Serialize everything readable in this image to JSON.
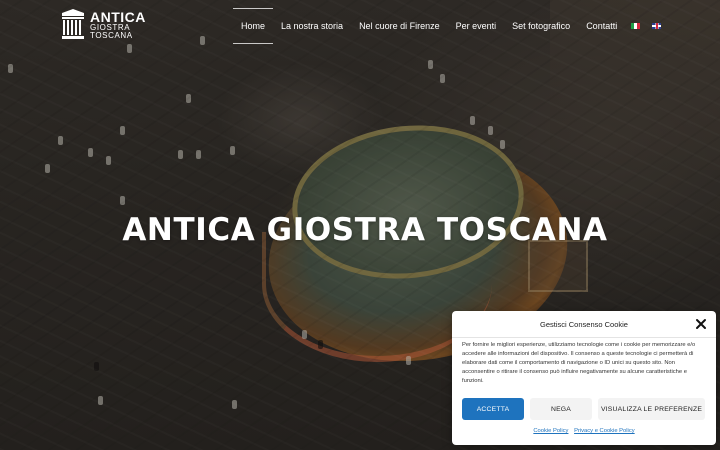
{
  "site": {
    "logo": {
      "line1": "ANTICA",
      "line2": "GIOSTRA",
      "line3": "TOSCANA"
    }
  },
  "nav": {
    "items": [
      {
        "label": "Home"
      },
      {
        "label": "La nostra storia"
      },
      {
        "label": "Nel cuore di Firenze"
      },
      {
        "label": "Per eventi"
      },
      {
        "label": "Set fotografico"
      },
      {
        "label": "Contatti"
      }
    ],
    "active_index": 0,
    "languages": [
      "it",
      "en"
    ]
  },
  "hero": {
    "title": "ANTICA GIOSTRA TOSCANA"
  },
  "cookie": {
    "title": "Gestisci Consenso Cookie",
    "body": "Per fornire le migliori esperienze, utilizziamo tecnologie come i cookie per memorizzare e/o accedere alle informazioni del dispositivo. Il consenso a queste tecnologie ci permetterà di elaborare dati come il comportamento di navigazione o ID unici su questo sito. Non acconsentire o ritirare il consenso può influire negativamente su alcune caratteristiche e funzioni.",
    "accept_label": "ACCETTA",
    "deny_label": "NEGA",
    "prefs_label": "VISUALIZZA LE PREFERENZE",
    "cookie_policy_label": "Cookie Policy",
    "privacy_label": "Privacy e Cookie Policy"
  },
  "colors": {
    "accent": "#1e73be",
    "button_secondary": "#f3f3f3",
    "text_light": "#ffffff"
  }
}
